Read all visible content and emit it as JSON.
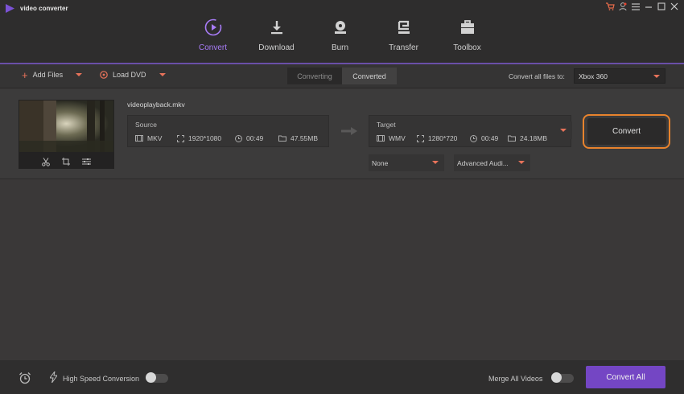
{
  "app": {
    "title": "video converter"
  },
  "tabs": [
    {
      "label": "Convert",
      "active": true
    },
    {
      "label": "Download"
    },
    {
      "label": "Burn"
    },
    {
      "label": "Transfer"
    },
    {
      "label": "Toolbox"
    }
  ],
  "toolbar": {
    "add_files": "Add Files",
    "load_dvd": "Load DVD",
    "seg_converting": "Converting",
    "seg_converted": "Converted",
    "convert_all_label": "Convert all files to:",
    "preset_value": "Xbox 360"
  },
  "file": {
    "name": "videoplayback.mkv",
    "source": {
      "label": "Source",
      "format": "MKV",
      "resolution": "1920*1080",
      "duration": "00:49",
      "size": "47.55MB"
    },
    "target": {
      "label": "Target",
      "format": "WMV",
      "resolution": "1280*720",
      "duration": "00:49",
      "size": "24.18MB"
    },
    "subtitle_select": "None",
    "audio_select": "Advanced Audi...",
    "convert_button": "Convert"
  },
  "bottom": {
    "high_speed": "High Speed Conversion",
    "merge": "Merge All Videos",
    "convert_all": "Convert All"
  },
  "colors": {
    "accent_purple": "#7446c4",
    "accent_orange": "#e8832d",
    "caret_orange": "#e8735a"
  }
}
